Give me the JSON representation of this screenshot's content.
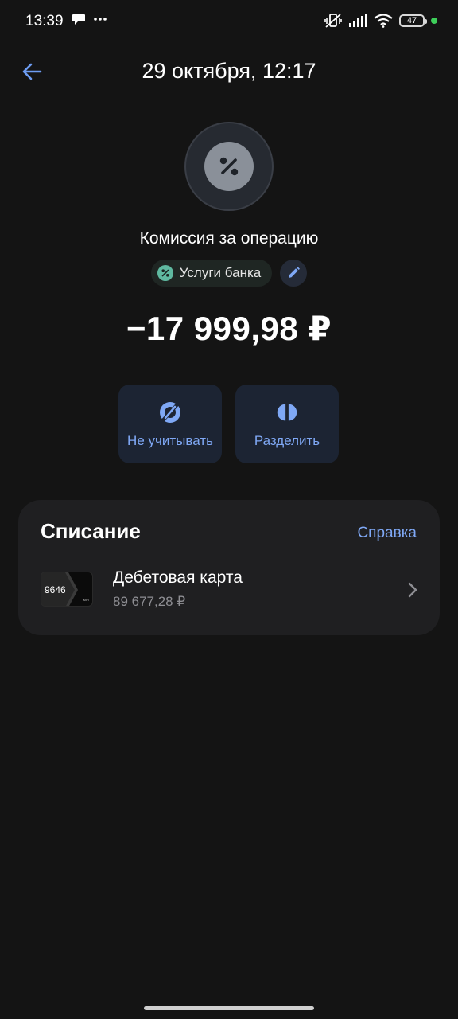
{
  "status_bar": {
    "time": "13:39",
    "battery": "47",
    "icons": [
      "chat-bubble-icon",
      "more-dots-icon",
      "vibrate-off-icon",
      "signal-icon",
      "wifi-icon",
      "battery-icon"
    ]
  },
  "header": {
    "title": "29 октября, 12:17",
    "back_icon": "arrow-left-icon"
  },
  "operation": {
    "category_icon": "percent-icon",
    "title": "Комиссия за операцию",
    "category_chip": "Услуги банка",
    "amount": "−17 999,98 ₽"
  },
  "actions": [
    {
      "label": "Не учитывать",
      "icon": "exclude-icon"
    },
    {
      "label": "Разделить",
      "icon": "split-icon"
    }
  ],
  "writeoff": {
    "title": "Списание",
    "help_link": "Справка",
    "account": {
      "card_number": "9646",
      "card_brand": "MIR",
      "name": "Дебетовая карта",
      "balance": "89 677,28 ₽"
    }
  },
  "colors": {
    "background": "#141414",
    "accent": "#7fa8f5",
    "card_surface": "#1f1f21",
    "action_surface": "#1c2433",
    "chip_icon": "#5fb9a0"
  }
}
